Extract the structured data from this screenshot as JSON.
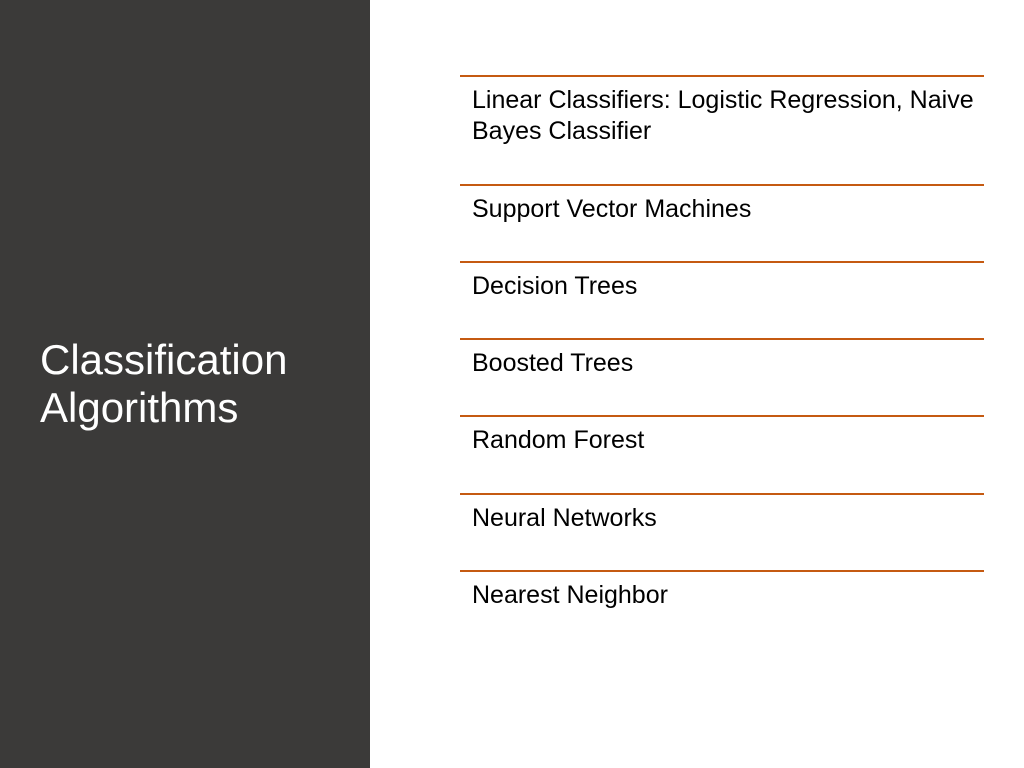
{
  "sidebar": {
    "title": "Classification Algorithms"
  },
  "content": {
    "items": [
      "Linear Classifiers: Logistic Regression, Naive Bayes Classifier",
      "Support Vector Machines",
      "Decision Trees",
      "Boosted Trees",
      "Random Forest",
      "Neural Networks",
      "Nearest Neighbor"
    ]
  },
  "colors": {
    "sidebar_bg": "#3b3a39",
    "accent": "#c55a11",
    "text_dark": "#000000",
    "text_light": "#ffffff"
  }
}
